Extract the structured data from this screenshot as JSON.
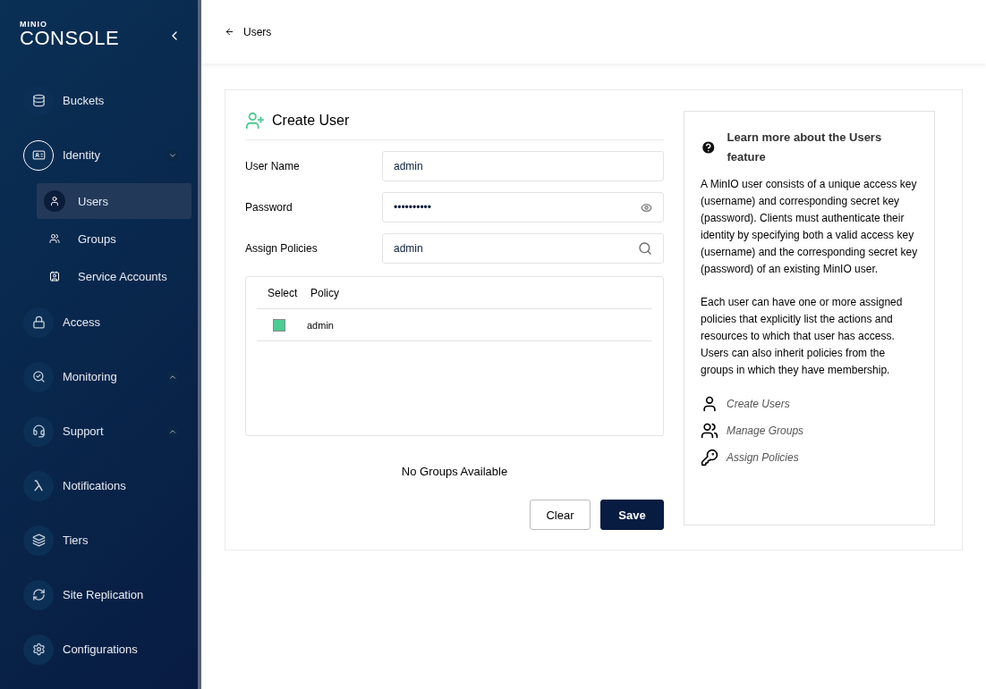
{
  "logo": {
    "brand": "MINIO",
    "product": "CONSOLE"
  },
  "sidebar": {
    "items": [
      {
        "label": "Buckets",
        "active": false
      },
      {
        "label": "Identity",
        "active": true,
        "expanded": true,
        "children": [
          {
            "label": "Users",
            "selected": true
          },
          {
            "label": "Groups",
            "selected": false
          },
          {
            "label": "Service Accounts",
            "selected": false
          }
        ]
      },
      {
        "label": "Access",
        "active": false
      },
      {
        "label": "Monitoring",
        "active": false,
        "expanded": false
      },
      {
        "label": "Support",
        "active": false,
        "expanded": false
      },
      {
        "label": "Notifications",
        "active": false
      },
      {
        "label": "Tiers",
        "active": false
      },
      {
        "label": "Site Replication",
        "active": false
      },
      {
        "label": "Configurations",
        "active": false
      }
    ]
  },
  "header": {
    "back_label": "Users"
  },
  "form": {
    "title": "Create User",
    "fields": [
      {
        "label": "User Name",
        "kind": "text",
        "value": "admin"
      },
      {
        "label": "Password",
        "kind": "password",
        "value": "••••••••••"
      },
      {
        "label": "Assign Policies",
        "kind": "search",
        "value": "admin"
      }
    ],
    "table": {
      "columns": [
        "Select",
        "Policy"
      ],
      "rows": [
        {
          "policy": "admin",
          "checked": true
        }
      ]
    },
    "groups_message": "No Groups Available",
    "buttons": [
      {
        "label": "Clear",
        "kind": "secondary"
      },
      {
        "label": "Save",
        "kind": "primary"
      }
    ]
  },
  "help": {
    "title": "Learn more about the Users feature",
    "paragraphs": [
      "A MinIO user consists of a unique access key (username) and corresponding secret key (password). Clients must authenticate their identity by specifying both a valid access key (username) and the corresponding secret key (password) of an existing MinIO user.",
      "Each user can have one or more assigned policies that explicitly list the actions and resources to which that user has access. Users can also inherit policies from the groups in which they have membership."
    ],
    "links": [
      {
        "label": "Create Users"
      },
      {
        "label": "Manage Groups"
      },
      {
        "label": "Assign Policies"
      }
    ]
  }
}
